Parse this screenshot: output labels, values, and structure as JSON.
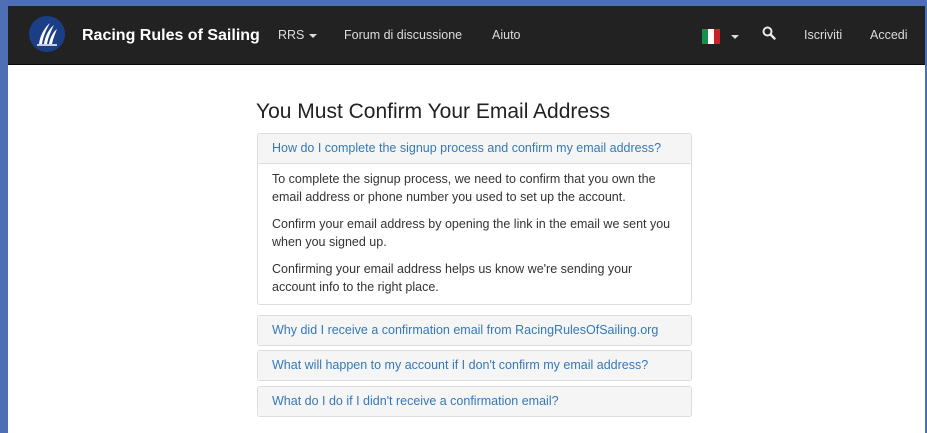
{
  "navbar": {
    "brand": "Racing Rules of Sailing",
    "items": [
      {
        "label": "RRS",
        "dropdown": true
      },
      {
        "label": "Forum di discussione"
      },
      {
        "label": "Aiuto"
      }
    ],
    "right": {
      "language_flag": "italy-flag-icon",
      "search_icon": "search-icon",
      "signup": "Iscriviti",
      "login": "Accedi"
    }
  },
  "colors": {
    "navbar_bg": "#222222",
    "link": "#3479b7",
    "panel_heading_bg": "#f5f5f5",
    "frame": "#4f6fb4"
  },
  "page": {
    "title": "You Must Confirm Your Email Address",
    "faq": [
      {
        "question": "How do I complete the signup process and confirm my email address?",
        "expanded": true,
        "answer": [
          "To complete the signup process, we need to confirm that you own the email address or phone number you used to set up the account.",
          "Confirm your email address by opening the link in the email we sent you when you signed up.",
          "Confirming your email address helps us know we're sending your account info to the right place."
        ]
      },
      {
        "question": "Why did I receive a confirmation email from RacingRulesOfSailing.org",
        "expanded": false
      },
      {
        "question": "What will happen to my account if I don't confirm my email address?",
        "expanded": false
      },
      {
        "question": "What do I do if I didn't receive a confirmation email?",
        "expanded": false
      }
    ]
  }
}
